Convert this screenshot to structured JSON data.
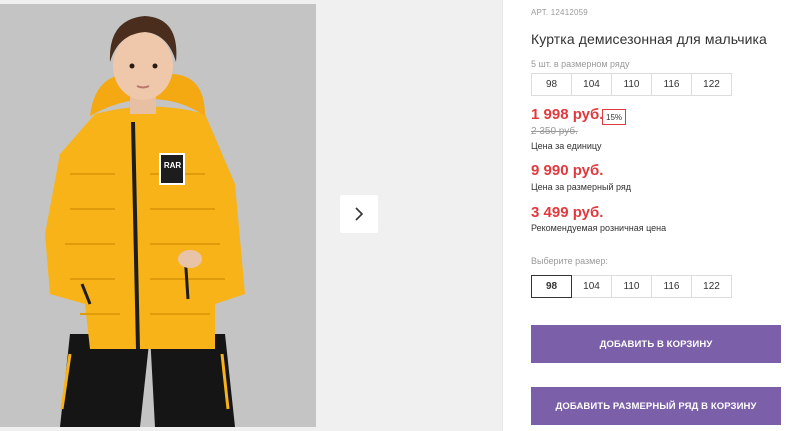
{
  "product": {
    "sku": "АРТ. 12412059",
    "title": "Куртка демисезонная для мальчика",
    "size_row_caption": "5 шт. в размерном ряду",
    "size_row": [
      "98",
      "104",
      "110",
      "116",
      "122"
    ],
    "price_unit": "1 998 руб.",
    "discount": "15%",
    "old_price": "2 350 руб.",
    "price_unit_note": "Цена за единицу",
    "price_row": "9 990 руб.",
    "price_row_note": "Цена за размерный ряд",
    "price_retail": "3 499 руб.",
    "price_retail_note": "Рекомендуемая розничная цена",
    "choose_size_label": "Выберите размер:",
    "sizes": [
      "98",
      "104",
      "110",
      "116",
      "122"
    ],
    "selected_size": "98",
    "add_to_cart_label": "ДОБАВИТЬ В КОРЗИНУ",
    "add_row_to_cart_label": "ДОБАВИТЬ РАЗМЕРНЫЙ РЯД В КОРЗИНУ"
  },
  "gallery": {
    "next_icon": "chevron-right-icon",
    "patch_text": "RAR"
  },
  "colors": {
    "accent_button": "#7b5fa8",
    "price_red": "#e03a3e",
    "jacket_yellow": "#f7b318"
  }
}
